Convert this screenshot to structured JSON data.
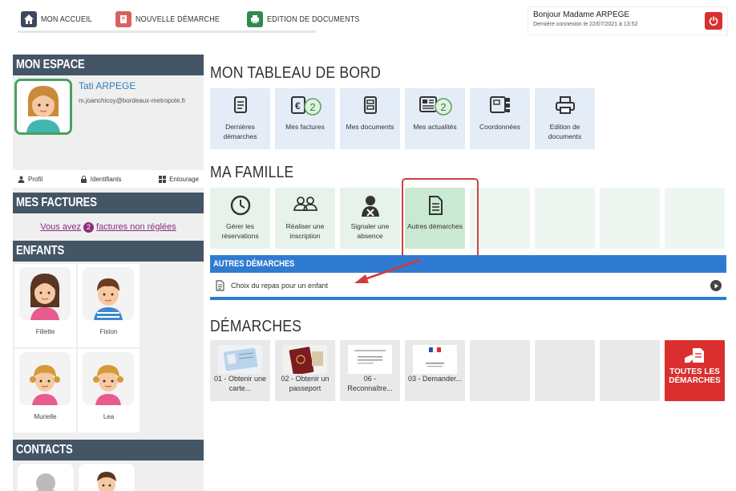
{
  "nav": {
    "home": "MON ACCUEIL",
    "new": "NOUVELLE DÉMARCHE",
    "docs": "EDITION DE DOCUMENTS"
  },
  "user": {
    "greeting": "Bonjour Madame ARPEGE",
    "last_connection": "Dernière connexion le 22/07/2021 à 13:52"
  },
  "sidebar": {
    "mon_espace": "MON ESPACE",
    "profile_name": "Tati ARPEGE",
    "profile_email": "m.joanchicoy@bordeaux-metropole.fr",
    "links": {
      "profil": "Profil",
      "identifiants": "Identifiants",
      "entourage": "Entourage"
    },
    "mes_factures": "MES FACTURES",
    "invoice_prefix": "Vous avez",
    "invoice_count": "2",
    "invoice_suffix": "factures non réglées",
    "enfants": "ENFANTS",
    "children": [
      "Fillette",
      "Fiston",
      "Murielle",
      "Lea"
    ],
    "contacts": "CONTACTS"
  },
  "dashboard": {
    "title": "MON TABLEAU DE BORD",
    "tiles": [
      {
        "label": "Dernières démarches"
      },
      {
        "label": "Mes factures",
        "badge": "2"
      },
      {
        "label": "Mes documents"
      },
      {
        "label": "Mes actualités",
        "badge": "2"
      },
      {
        "label": "Coordonnées"
      },
      {
        "label": "Edition de documents"
      }
    ]
  },
  "famille": {
    "title": "MA FAMILLE",
    "tiles": [
      {
        "label": "Gérer les réservations"
      },
      {
        "label": "Réaliser une inscription"
      },
      {
        "label": "Signaler une absence"
      },
      {
        "label": "Autres démarches"
      }
    ],
    "autres_header": "AUTRES DÉMARCHES",
    "autres_item": "Choix du repas pour un enfant"
  },
  "demarches": {
    "title": "DÉMARCHES",
    "tiles": [
      {
        "label": "01 - Obtenir une carte..."
      },
      {
        "label": "02 - Obtenir un passeport"
      },
      {
        "label": "06 - Reconnaître..."
      },
      {
        "label": "03 - Demander..."
      }
    ],
    "all": "TOUTES LES DÉMARCHES"
  },
  "colors": {
    "sidebar_header": "#445566",
    "accent_blue": "#2f7bd2",
    "accent_red": "#d9302f",
    "invoice_purple": "#8a2d7f",
    "avatar_green": "#4aa15f"
  }
}
